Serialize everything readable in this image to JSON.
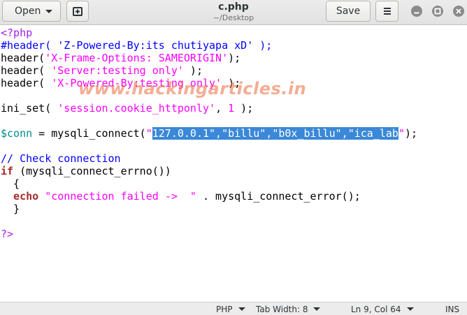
{
  "header": {
    "open_label": "Open",
    "save_label": "Save",
    "filename": "c.php",
    "path": "~/Desktop"
  },
  "editor": {
    "line1": "<?php",
    "line2": "#header( 'Z-Powered-By:its chutiyapa xD' );",
    "line3_fn": "header(",
    "line3_str": "'X-Frame-Options: SAMEORIGIN'",
    "line3_end": ");",
    "line4_fn": "header(",
    "line4_str": " 'Server:testing only'",
    "line4_end": " );",
    "line5_fn": "header(",
    "line5_str": " 'X-Powered-By:testing only'",
    "line5_end": " );",
    "line7_fn": "ini_set(",
    "line7_str": " 'session.cookie_httponly'",
    "line7_mid": ", ",
    "line7_num": "1",
    "line7_end": " );",
    "line9_var": "$conn",
    "line9_eq": " = ",
    "line9_fn": "mysqli_connect(",
    "line9_q": "\"",
    "line9_sel": "127.0.0.1\",\"billu\",\"b0x_billu\",\"ica_lab",
    "line9_q2": "\"",
    "line9_end": ");",
    "line11": "// Check connection",
    "line12_kw": "if",
    "line12_rest": " (mysqli_connect_errno())",
    "line13": "  {",
    "line14_kw": "  echo",
    "line14_str": " \"connection failed ->  \"",
    "line14_rest": " . mysqli_connect_error();",
    "line15": "  }",
    "line17": "?>"
  },
  "watermark": "www.hackingarticles.in",
  "status": {
    "language": "PHP",
    "tab_width": "Tab Width: 8",
    "position": "Ln 9, Col 64",
    "mode": "INS"
  }
}
